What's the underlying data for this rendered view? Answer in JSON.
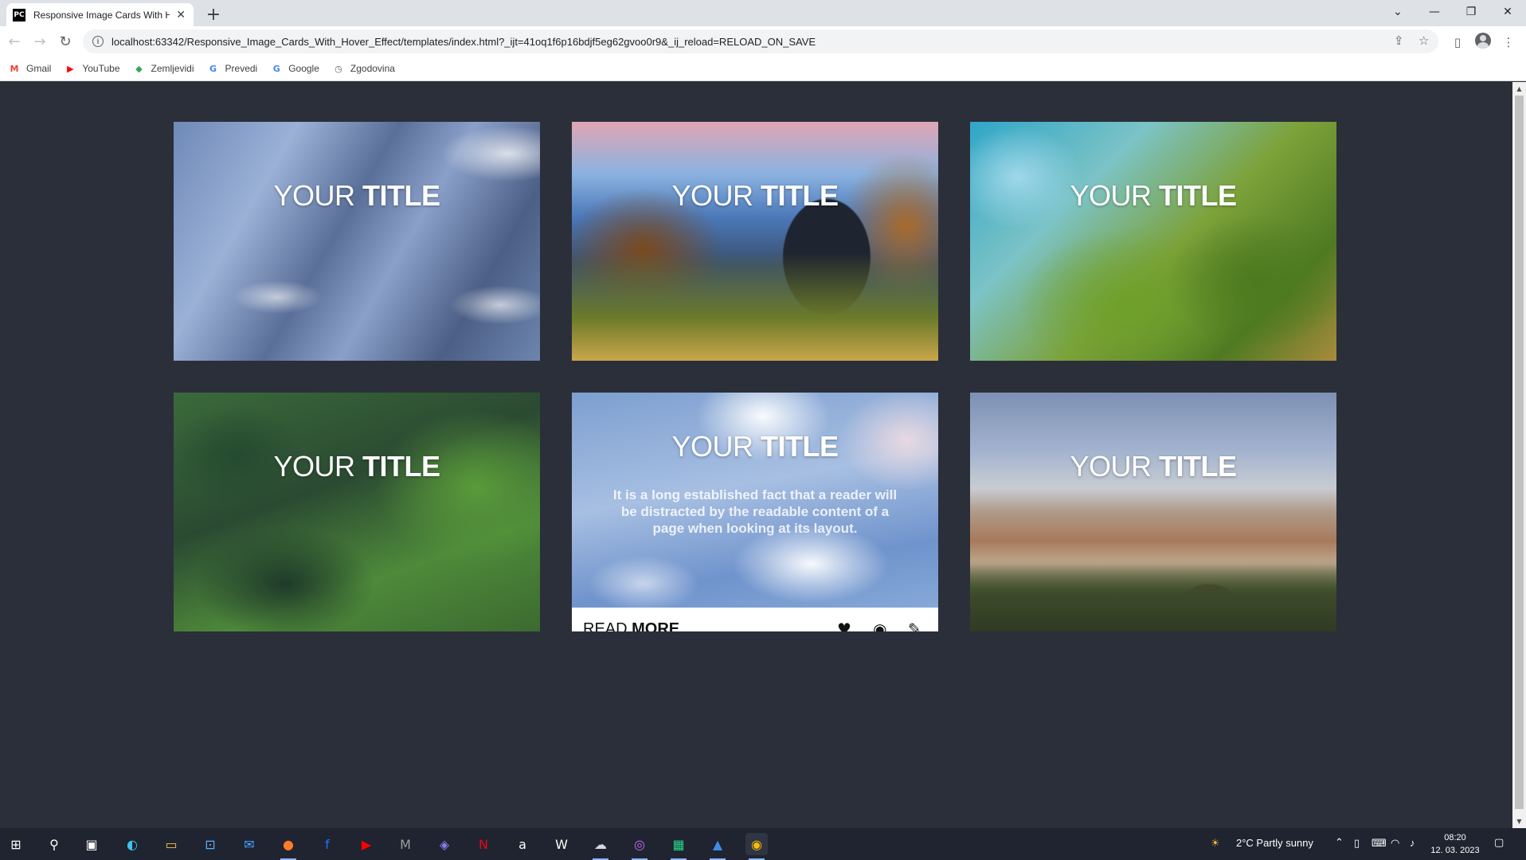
{
  "browser": {
    "tab_title": "Responsive Image Cards With Ho",
    "tab_favicon": "PC",
    "url": "localhost:63342/Responsive_Image_Cards_With_Hover_Effect/templates/index.html?_ijt=41oq1f6p16bdjf5eg62gvoo0r9&_ij_reload=RELOAD_ON_SAVE",
    "bookmarks": [
      {
        "label": "Gmail",
        "icon": "gmail-icon",
        "glyph": "M",
        "color": "#ea4335"
      },
      {
        "label": "YouTube",
        "icon": "youtube-icon",
        "glyph": "▶",
        "color": "#ff0000"
      },
      {
        "label": "Zemljevidi",
        "icon": "maps-icon",
        "glyph": "◆",
        "color": "#34a853"
      },
      {
        "label": "Prevedi",
        "icon": "translate-icon",
        "glyph": "G",
        "color": "#4285f4"
      },
      {
        "label": "Google",
        "icon": "google-icon",
        "glyph": "G",
        "color": "#4285f4"
      },
      {
        "label": "Zgodovina",
        "icon": "history-icon",
        "glyph": "◷",
        "color": "#5f6368"
      }
    ]
  },
  "cards": [
    {
      "title_light": "YOUR",
      "title_bold": "TITLE"
    },
    {
      "title_light": "YOUR",
      "title_bold": "TITLE"
    },
    {
      "title_light": "YOUR",
      "title_bold": "TITLE"
    },
    {
      "title_light": "YOUR",
      "title_bold": "TITLE"
    },
    {
      "title_light": "YOUR",
      "title_bold": "TITLE",
      "text": "It is a long established fact that a reader will be distracted by the readable content of a page when looking at its layout.",
      "footer_light": "READ",
      "footer_bold": "MORE"
    },
    {
      "title_light": "YOUR",
      "title_bold": "TITLE"
    }
  ],
  "taskbar": {
    "weather": "2°C  Partly sunny",
    "time": "08:20",
    "date": "12. 03. 2023"
  },
  "colors": {
    "page_background": "#2b2f39",
    "chrome_tabbar": "#dee1e6",
    "taskbar": "#1f2430"
  }
}
